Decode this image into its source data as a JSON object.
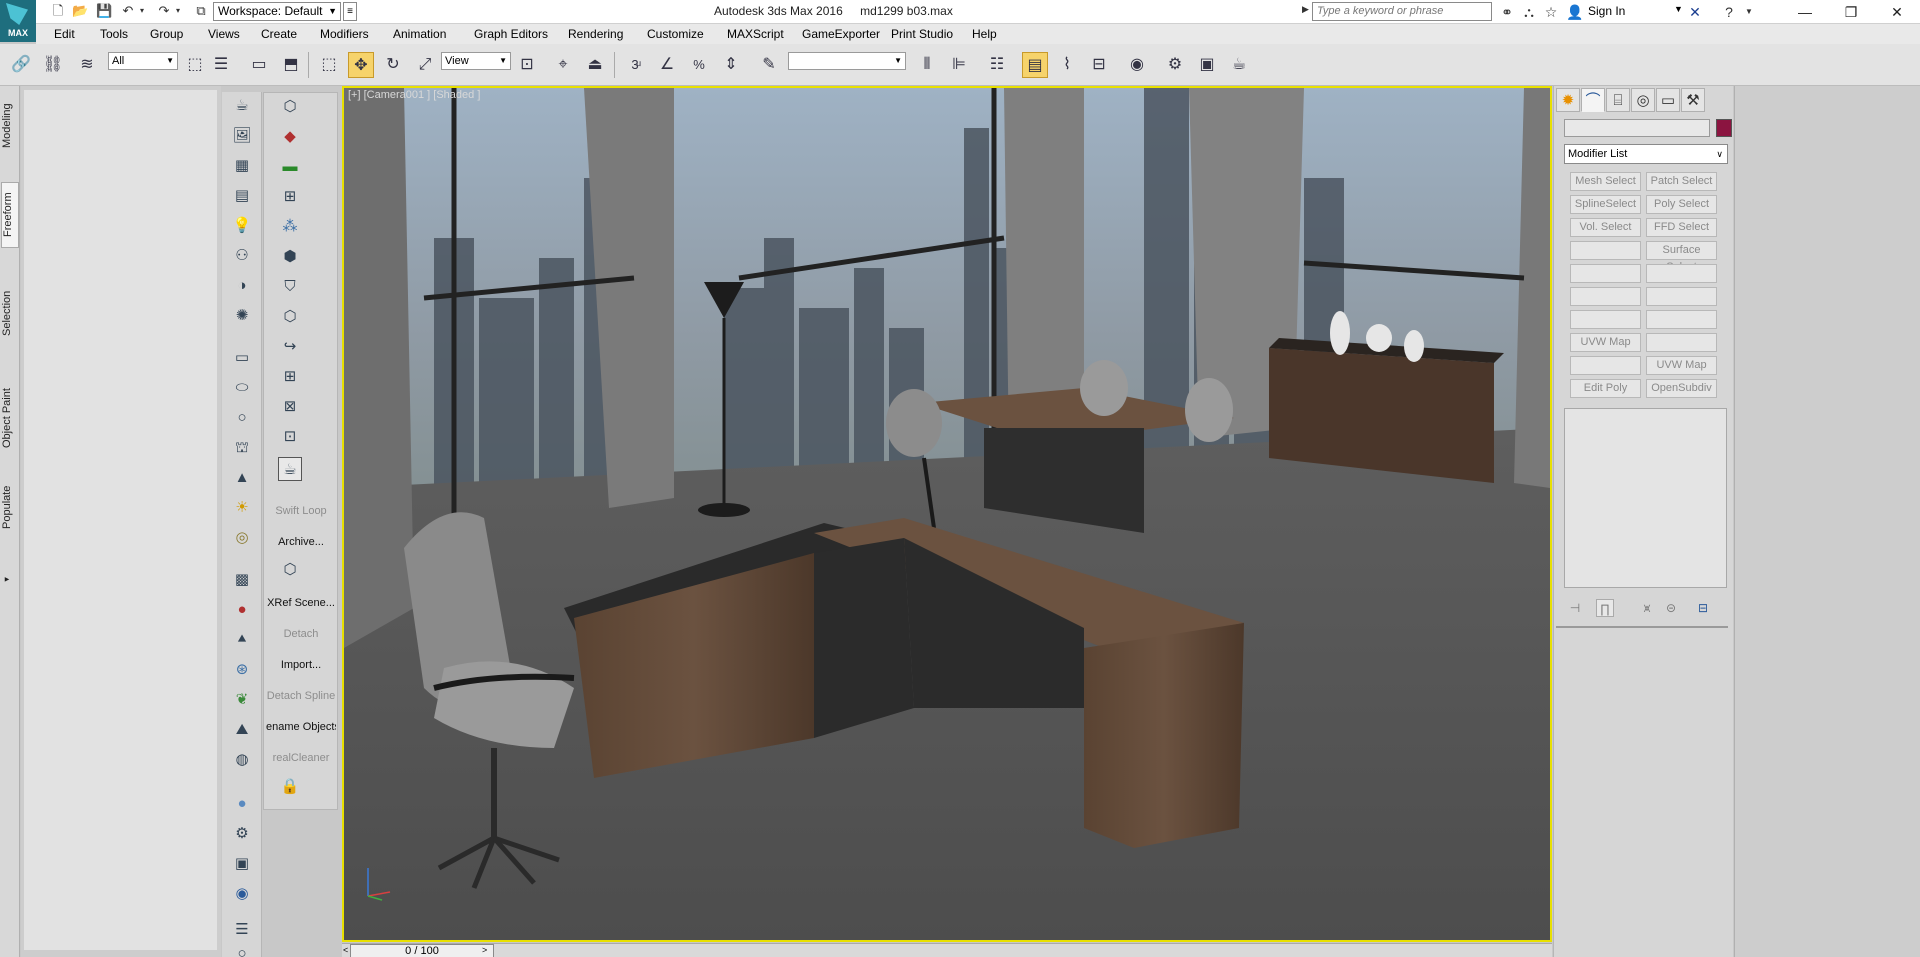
{
  "app": {
    "logo_text": "MAX",
    "window_title": "Autodesk 3ds Max 2016",
    "file_name": "md1299 b03.max",
    "workspace": "Workspace: Default",
    "search_placeholder": "Type a keyword or phrase",
    "sign_in": "Sign In"
  },
  "menu": [
    "Edit",
    "Tools",
    "Group",
    "Views",
    "Create",
    "Modifiers",
    "Animation",
    "Graph Editors",
    "Rendering",
    "Customize",
    "MAXScript",
    "GameExporter",
    "Print Studio",
    "Help"
  ],
  "toolbar": {
    "selection_filter": "All",
    "reference_coord": "View",
    "named_selection": ""
  },
  "ribbon_tabs": [
    "Modeling",
    "Freeform",
    "Selection",
    "Object Paint",
    "Populate"
  ],
  "ribbon_active_tab": "Freeform",
  "left_panel_labels": [
    {
      "text": "Swift Loop",
      "enabled": false
    },
    {
      "text": "Archive...",
      "enabled": true
    },
    {
      "text": "XRef Scene...",
      "enabled": true
    },
    {
      "text": "Detach",
      "enabled": false
    },
    {
      "text": "Import...",
      "enabled": true
    },
    {
      "text": "Detach Spline",
      "enabled": false
    },
    {
      "text": "ename Objects",
      "enabled": true
    },
    {
      "text": "realCleaner",
      "enabled": false
    }
  ],
  "viewport": {
    "label": "[+] [Camera001 ] [Shaded ]"
  },
  "timeline": {
    "frame_display": "0 / 100"
  },
  "command_panel": {
    "object_color": "#8b1440",
    "modifier_list": "Modifier List",
    "modifier_buttons": [
      {
        "label": "Mesh Select"
      },
      {
        "label": "Patch Select"
      },
      {
        "label": "SplineSelect"
      },
      {
        "label": "Poly Select"
      },
      {
        "label": "Vol. Select"
      },
      {
        "label": "FFD Select"
      },
      {
        "label": ""
      },
      {
        "label": "Surface Select"
      },
      {
        "label": ""
      },
      {
        "label": ""
      },
      {
        "label": ""
      },
      {
        "label": ""
      },
      {
        "label": ""
      },
      {
        "label": ""
      },
      {
        "label": "UVW Map"
      },
      {
        "label": ""
      },
      {
        "label": ""
      },
      {
        "label": "UVW Map"
      },
      {
        "label": "Edit Poly"
      },
      {
        "label": "OpenSubdiv"
      }
    ]
  }
}
